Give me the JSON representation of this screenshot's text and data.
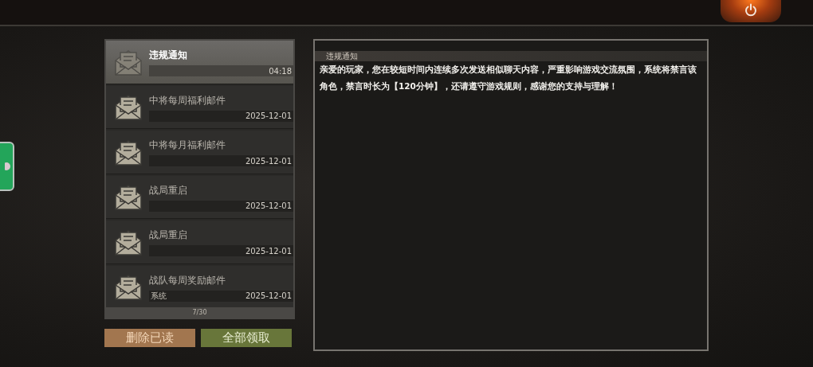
{
  "mail_list": {
    "items": [
      {
        "title": "违规通知",
        "time": "04:18",
        "selected": true
      },
      {
        "title": "中将每周福利邮件",
        "time": "2025-12-01",
        "selected": false
      },
      {
        "title": "中将每月福利邮件",
        "time": "2025-12-01",
        "selected": false
      },
      {
        "title": "战局重启",
        "time": "2025-12-01",
        "selected": false
      },
      {
        "title": "战局重启",
        "time": "2025-12-01",
        "selected": false
      },
      {
        "title": "战队每周奖励邮件",
        "sender": "系统",
        "time": "2025-12-01",
        "selected": false
      }
    ],
    "pager": "7/30"
  },
  "buttons": [
    {
      "label": "删除已读",
      "kind": "delete"
    },
    {
      "label": "全部领取",
      "kind": "claim"
    }
  ],
  "detail": {
    "title": "违规通知",
    "body": "亲爱的玩家，您在较短时间内连续多次发送相似聊天内容，严重影响游戏交流氛围，系统将禁言该角色，禁言时长为【120分钟】，还请遵守游戏规则，感谢您的支持与理解！"
  }
}
